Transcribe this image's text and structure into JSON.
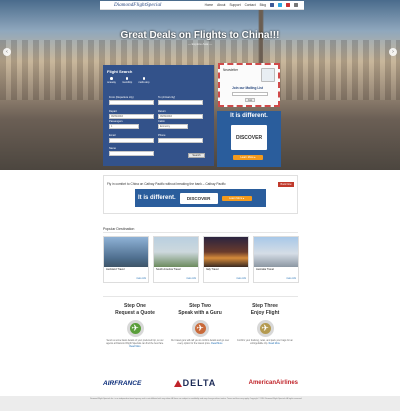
{
  "brand": {
    "logo": "DiamondFlightSpecial"
  },
  "nav": {
    "items": [
      "Home",
      "About",
      "Support",
      "Contact",
      "Blog"
    ]
  },
  "hero": {
    "title": "Great Deals on Flights to China!!!",
    "subtitle": "— Explore Asia —"
  },
  "flight_search": {
    "title": "Flight Search",
    "trip_types": [
      "oneway",
      "roundtrip",
      "multi-stop"
    ],
    "from_label": "From (Departure city)",
    "to_label": "To (Arrival city)",
    "depart_label": "Depart",
    "depart_value": "06/09/2016",
    "return_label": "Return",
    "return_value": "06/09/2016",
    "passengers_label": "Passengers",
    "passengers_value": "1",
    "cabin_label": "Cabin",
    "cabin_value": "Economy",
    "email_label": "Email",
    "phone_label": "Phone",
    "name_label": "Name",
    "search_button": "Search"
  },
  "newsletter": {
    "title": "Newsletter",
    "join_label": "Join our Mailing List",
    "button": "Join"
  },
  "ad": {
    "headline": "It is different.",
    "brand": "DISCOVER",
    "cta": "Learn More ▸"
  },
  "promo": {
    "message": "Fly in comfort to China on Cathay Pacific without breaking the bank – Cathay Pacific",
    "button": "Book Now"
  },
  "popular": {
    "title": "Popular Destination",
    "items": [
      {
        "name": "Auckland Travel",
        "more": "more info"
      },
      {
        "name": "South America Travel",
        "more": "more info"
      },
      {
        "name": "Italy Travel",
        "more": "more info"
      },
      {
        "name": "Australia Travel",
        "more": "more info"
      }
    ]
  },
  "steps": [
    {
      "line1": "Step One",
      "line2": "Request a Quote",
      "desc": "Send us some basic details of your preferred trip, so our agents at Diamond Flight Specials can find the best fare.",
      "more": "Read More"
    },
    {
      "line1": "Step Two",
      "line2": "Speak with a Guru",
      "desc": "Our travel guru will call you to confirm details and go over every option for the lowest price.",
      "more": "Read More"
    },
    {
      "line1": "Step Three",
      "line2": "Enjoy Flight",
      "desc": "Confirm your booking, relax, and pack your bags for an unforgettable trip.",
      "more": "Read More"
    }
  ],
  "airlines": {
    "af": "AIRFRANCE",
    "delta": "DELTA",
    "aa": "AmericanAirlines"
  },
  "footer": {
    "text": "Diamond Flight Specials Inc. is an independent travel agency and is not affiliated with any airline. All fares are subject to availability and may change without notice. Taxes and fees may apply. Copyright © 2016 Diamond Flight Specials. All rights reserved."
  },
  "colors": {
    "primary": "#33528a",
    "accent": "#f39a1d",
    "promo_red": "#c0392b"
  }
}
